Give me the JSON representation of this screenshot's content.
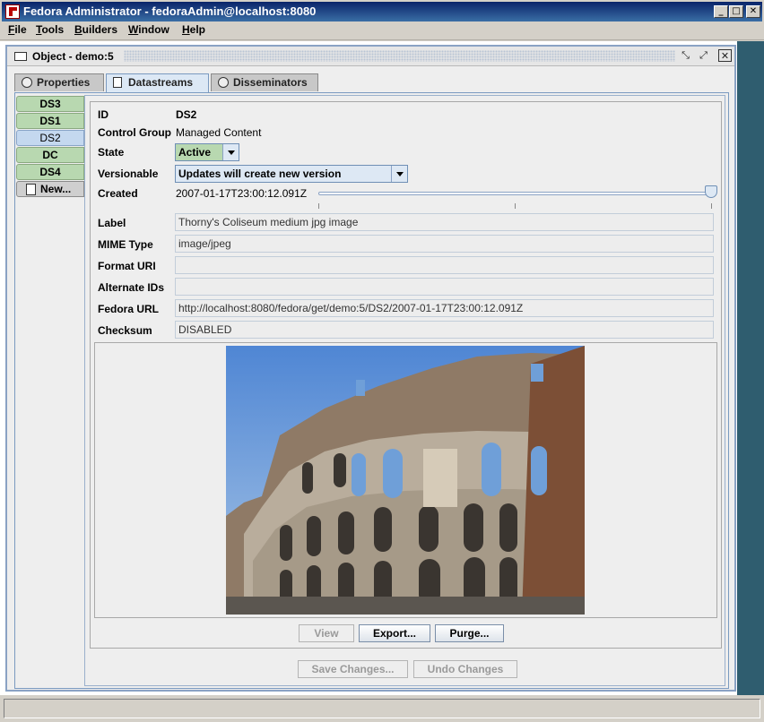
{
  "window": {
    "title": "Fedora Administrator - fedoraAdmin@localhost:8080",
    "minimize": "_",
    "maximize": "□",
    "close": "✕"
  },
  "menu": {
    "items": [
      {
        "key": "F",
        "rest": "ile"
      },
      {
        "key": "T",
        "rest": "ools"
      },
      {
        "key": "B",
        "rest": "uilders"
      },
      {
        "key": "W",
        "rest": "indow"
      },
      {
        "key": "H",
        "rest": "elp"
      }
    ]
  },
  "internal_frame": {
    "title": "Object - demo:5",
    "tabs": [
      {
        "label": "Properties"
      },
      {
        "label": "Datastreams"
      },
      {
        "label": "Disseminators"
      }
    ]
  },
  "datastreams": {
    "items": [
      {
        "label": "DS3"
      },
      {
        "label": "DS1"
      },
      {
        "label": "DS2",
        "selected": true
      },
      {
        "label": "DC"
      },
      {
        "label": "DS4"
      }
    ],
    "new_label": "New..."
  },
  "details": {
    "id_label": "ID",
    "id_value": "DS2",
    "control_group_label": "Control Group",
    "control_group_value": "Managed Content",
    "state_label": "State",
    "state_value": "Active",
    "versionable_label": "Versionable",
    "versionable_value": "Updates will create new version",
    "created_label": "Created",
    "created_value": "2007-01-17T23:00:12.091Z",
    "created_slider_fraction": 1.0,
    "label_label": "Label",
    "label_value": "Thorny's Coliseum medium jpg image",
    "mime_label": "MIME Type",
    "mime_value": "image/jpeg",
    "format_uri_label": "Format URI",
    "format_uri_value": "",
    "alt_ids_label": "Alternate IDs",
    "alt_ids_value": "",
    "fedora_url_label": "Fedora URL",
    "fedora_url_value": "http://localhost:8080/fedora/get/demo:5/DS2/2007-01-17T23:00:12.091Z",
    "checksum_label": "Checksum",
    "checksum_value": "DISABLED"
  },
  "content_buttons": {
    "view": "View",
    "export": "Export...",
    "purge": "Purge..."
  },
  "bottom_buttons": {
    "save": "Save Changes...",
    "undo": "Undo Changes"
  },
  "colors": {
    "title_bar": "#0a246a",
    "active_state": "#b8d8b0",
    "selection": "#c4d8ef",
    "desktop_strip": "#2f5d6f"
  }
}
